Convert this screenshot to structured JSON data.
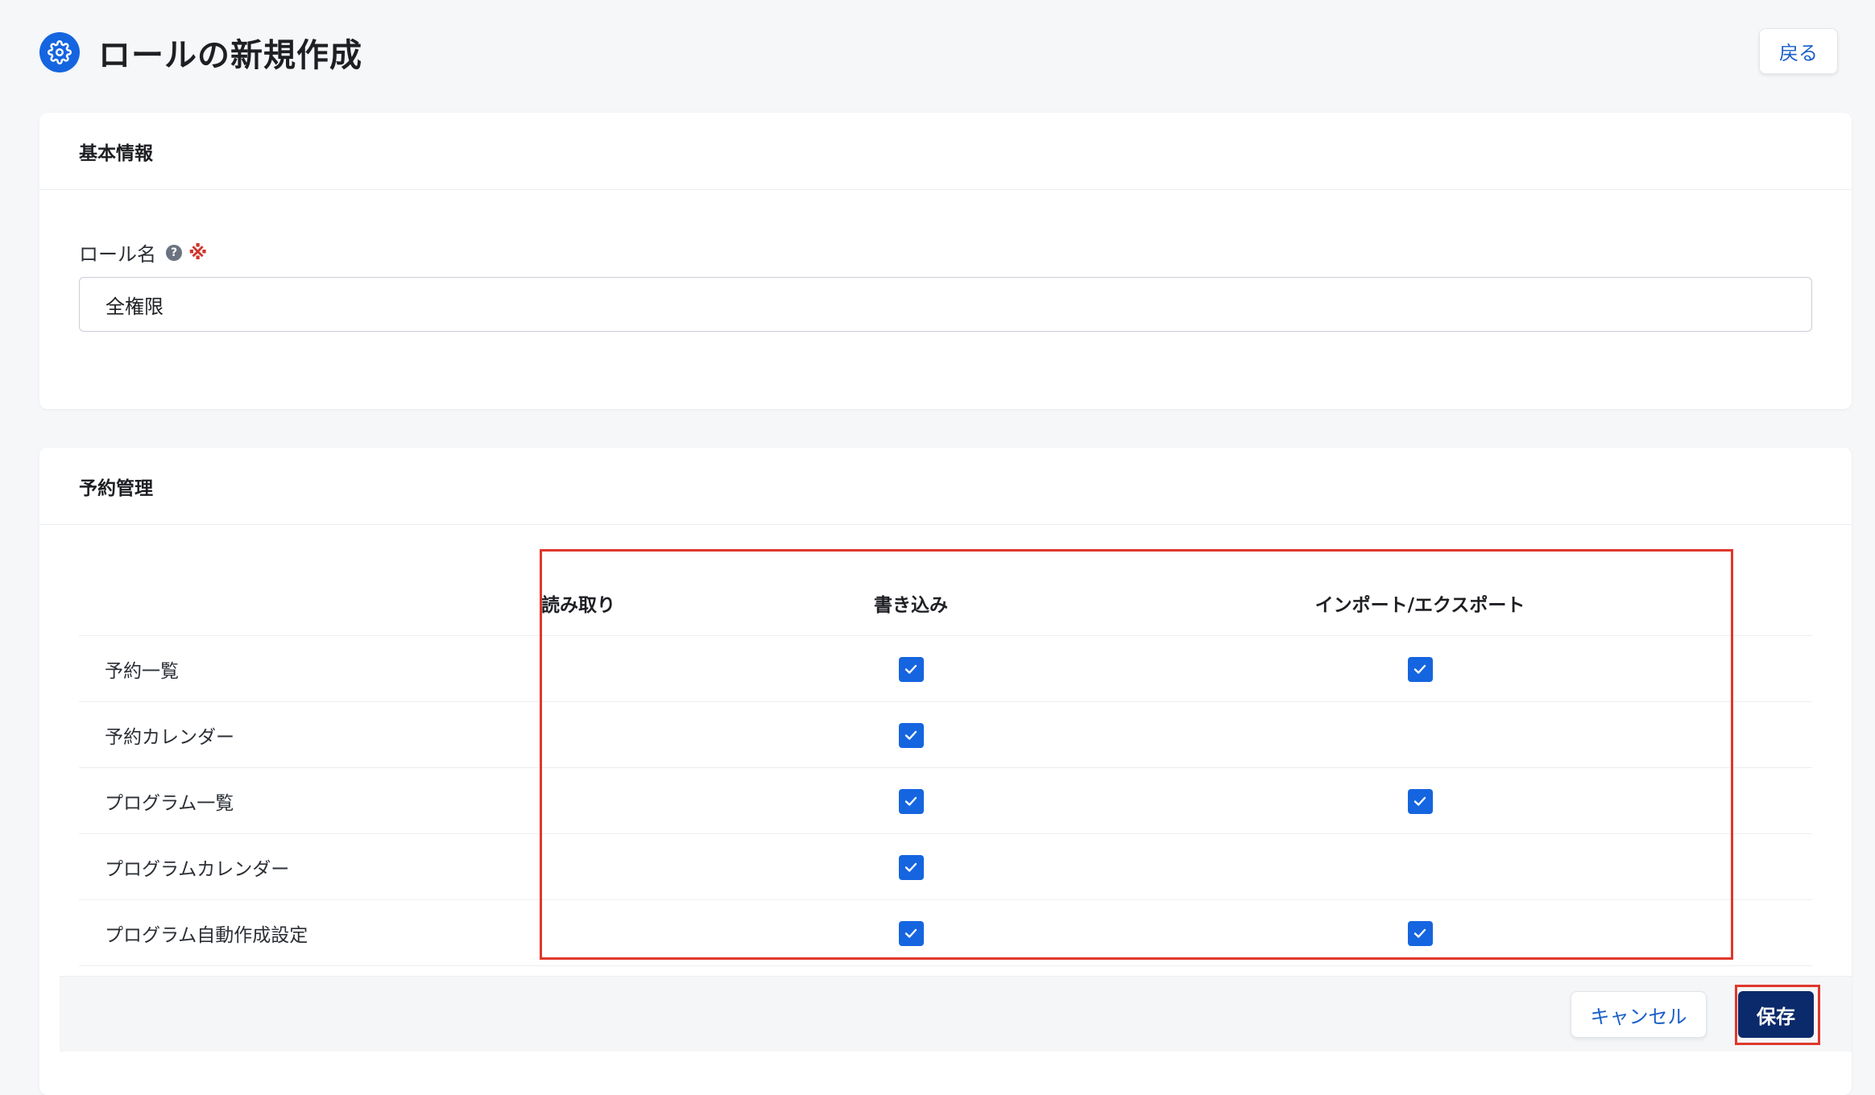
{
  "header": {
    "icon": "gear-icon",
    "title": "ロールの新規作成",
    "back_label": "戻る"
  },
  "basic_info": {
    "title": "基本情報",
    "role_name_label": "ロール名",
    "help_icon": "question-circle-icon",
    "required_mark": "※",
    "role_name_value": "全権限"
  },
  "reservation": {
    "title": "予約管理",
    "columns": [
      "読み取り",
      "書き込み",
      "インポート/エクスポート"
    ],
    "rows": [
      {
        "label": "予約一覧",
        "read": false,
        "write": true,
        "import_export": true
      },
      {
        "label": "予約カレンダー",
        "read": false,
        "write": true,
        "import_export": false
      },
      {
        "label": "プログラム一覧",
        "read": false,
        "write": true,
        "import_export": true
      },
      {
        "label": "プログラムカレンダー",
        "read": false,
        "write": true,
        "import_export": false
      },
      {
        "label": "プログラム自動作成設定",
        "read": false,
        "write": true,
        "import_export": true
      }
    ]
  },
  "actions": {
    "cancel_label": "キャンセル",
    "save_label": "保存"
  },
  "colors": {
    "primary": "#1565e0",
    "save_button": "#0b2a6b",
    "link": "#1a5fc9",
    "highlight": "#e0372b",
    "required": "#d0342c"
  }
}
